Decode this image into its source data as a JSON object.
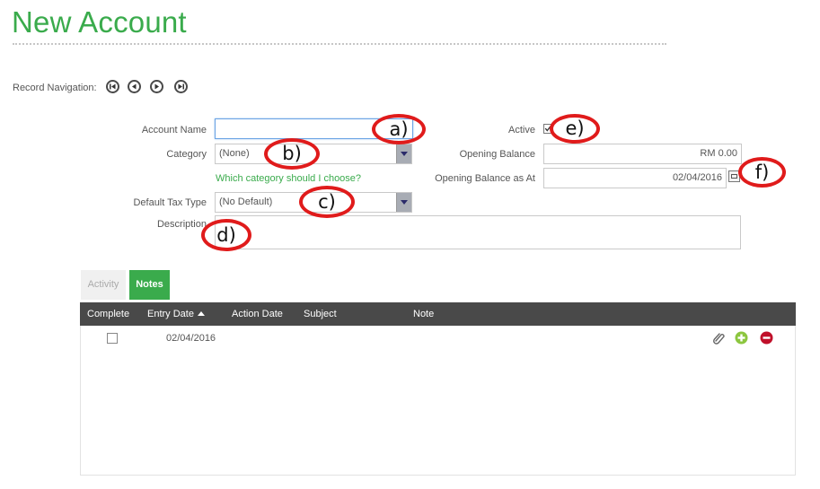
{
  "page": {
    "title": "New Account"
  },
  "record_navigation": {
    "label": "Record Navigation:",
    "buttons": [
      "first-record",
      "previous-record",
      "next-record",
      "last-record"
    ]
  },
  "form": {
    "account_name": {
      "label": "Account Name",
      "value": ""
    },
    "category": {
      "label": "Category",
      "value": "(None)",
      "help_link": "Which category should I choose?"
    },
    "default_tax_type": {
      "label": "Default Tax Type",
      "value": "(No Default)"
    },
    "description": {
      "label": "Description",
      "value": ""
    },
    "active": {
      "label": "Active",
      "checked": true
    },
    "opening_balance": {
      "label": "Opening Balance",
      "value": "RM 0.00"
    },
    "opening_balance_as_at": {
      "label": "Opening Balance as At",
      "value": "02/04/2016"
    }
  },
  "annotations": {
    "a": "a)",
    "b": "b)",
    "c": "c)",
    "d": "d)",
    "e": "e)",
    "f": "f)"
  },
  "tabs": {
    "activity": "Activity",
    "notes": "Notes",
    "selected": "Notes"
  },
  "grid": {
    "columns": [
      "Complete",
      "Entry Date",
      "Action Date",
      "Subject",
      "Note"
    ],
    "sorted_column": "Entry Date",
    "rows": [
      {
        "complete": false,
        "entry_date": "02/04/2016",
        "action_date": "",
        "subject": "",
        "note": ""
      }
    ]
  },
  "colors": {
    "accent": "#3aab4c",
    "header_bg": "#494949",
    "annotation": "#e01b1b"
  }
}
